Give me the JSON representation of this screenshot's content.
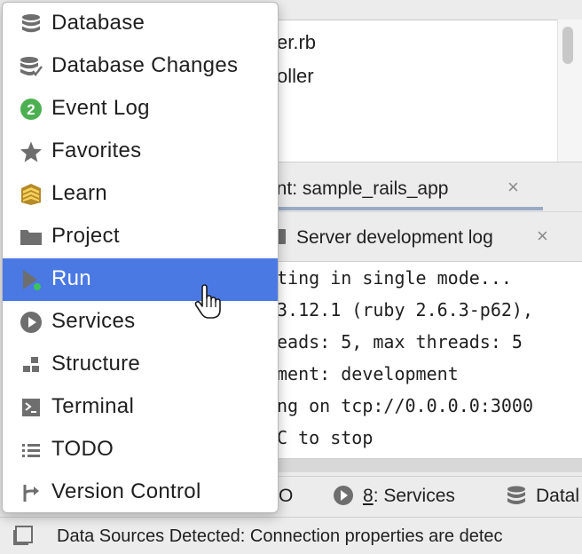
{
  "editor": {
    "lines": [
      "er.rb",
      "oller"
    ]
  },
  "tabs": {
    "run_tab": {
      "label": "ent: sample_rails_app",
      "close": "×"
    },
    "log_tab": {
      "label": "Server development log",
      "close": "×"
    }
  },
  "console": {
    "lines": [
      "ting in single mode...",
      " 3.12.1 (ruby 2.6.3-p62),",
      "eads: 5, max threads: 5",
      "ment: development",
      "ng on tcp://0.0.0.0:3000",
      "C to stop"
    ]
  },
  "tool_window_bar": {
    "todo_fragment": "O",
    "services_number": "8",
    "services_label": ": Services",
    "database_fragment": "Datal"
  },
  "status_bar": {
    "message": "Data Sources Detected: Connection properties are detec"
  },
  "menu": {
    "items": [
      {
        "label": "Database",
        "icon": "database-icon"
      },
      {
        "label": "Database Changes",
        "icon": "database-changes-icon"
      },
      {
        "label": "Event Log",
        "icon": "event-log-icon",
        "badge": "2"
      },
      {
        "label": "Favorites",
        "icon": "star-icon"
      },
      {
        "label": "Learn",
        "icon": "learn-icon"
      },
      {
        "label": "Project",
        "icon": "folder-icon"
      },
      {
        "label": "Run",
        "icon": "run-icon",
        "selected": true
      },
      {
        "label": "Services",
        "icon": "services-icon"
      },
      {
        "label": "Structure",
        "icon": "structure-icon"
      },
      {
        "label": "Terminal",
        "icon": "terminal-icon"
      },
      {
        "label": "TODO",
        "icon": "todo-icon"
      },
      {
        "label": "Version Control",
        "icon": "version-control-icon"
      }
    ]
  },
  "colors": {
    "selection": "#4b79e4",
    "event_badge": "#4caf50",
    "icon_gray": "#6e6e6e"
  }
}
